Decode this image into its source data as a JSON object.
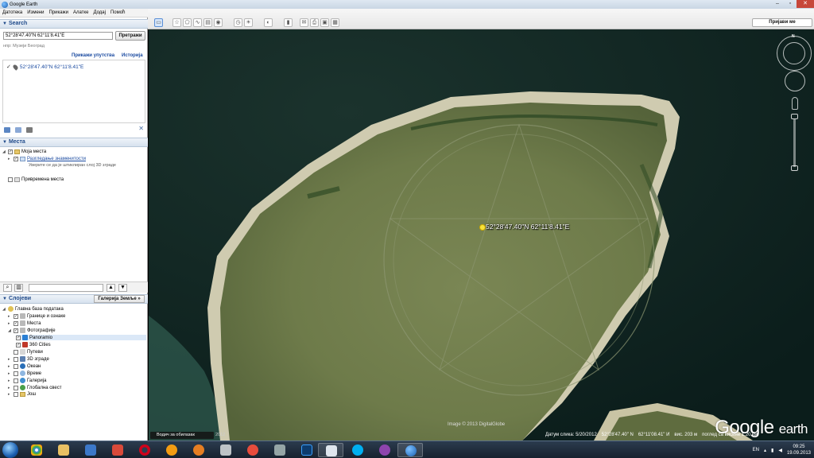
{
  "window": {
    "title": "Google Earth",
    "minimize": "–",
    "maximize": "▫",
    "close": "✕"
  },
  "menu": [
    "Датотека",
    "Измени",
    "Прикажи",
    "Алатке",
    "Додај",
    "Помоћ"
  ],
  "toolbar": {
    "signin_label": "Пријави ме"
  },
  "search": {
    "header": "Search",
    "query": "52°28'47.40\"N 62°11'8.41\"E",
    "button": "Претражи",
    "hint": "нпр: Музеји Београд",
    "directions_link": "Прикажи упутства",
    "history_link": "Историја",
    "result": "52°28'47.40\"N 62°11'8.41\"E"
  },
  "places": {
    "header": "Места",
    "my_places": "Моја места",
    "sightseeing": "Разгледање знаменитости",
    "sightseeing_note": "Уверите се да је штиклиран слој 3D зграде",
    "temp_places": "Привремена места"
  },
  "layers": {
    "header": "Слојеви",
    "gallery_button": "Галерија Земље »",
    "items": [
      "Главна база података",
      "Границе и ознаке",
      "Места",
      "Фотографије",
      "Panoramio",
      "360 Cities",
      "Путеви",
      "3D зграде",
      "Океан",
      "Време",
      "Галерија",
      "Глобална свест",
      "Још"
    ]
  },
  "map": {
    "placemark_label": "52°28'47.40\"N 62°11'8.41\"E",
    "logo_main": "Google",
    "logo_sub": "earth",
    "copyright": "Image © 2013 DigitalGlobe",
    "tour_button": "Водич за обилазак",
    "tour_year": "2012",
    "north": "N",
    "status": {
      "date": "Датум слика: 5/20/2012",
      "lat": "52°28'47.40\" N",
      "lon": "62°11'08.41\" И",
      "elev": "виc.  203 м",
      "eye": "поглед са висине   1.20 км"
    }
  },
  "taskbar": {
    "lang": "EN",
    "time": "09:25",
    "date": "19.09.2013"
  },
  "colors": {
    "water": "#0f2422",
    "land": "#6f7d4c",
    "sand": "#d8d3b8",
    "accent_link": "#1a4aa0"
  }
}
